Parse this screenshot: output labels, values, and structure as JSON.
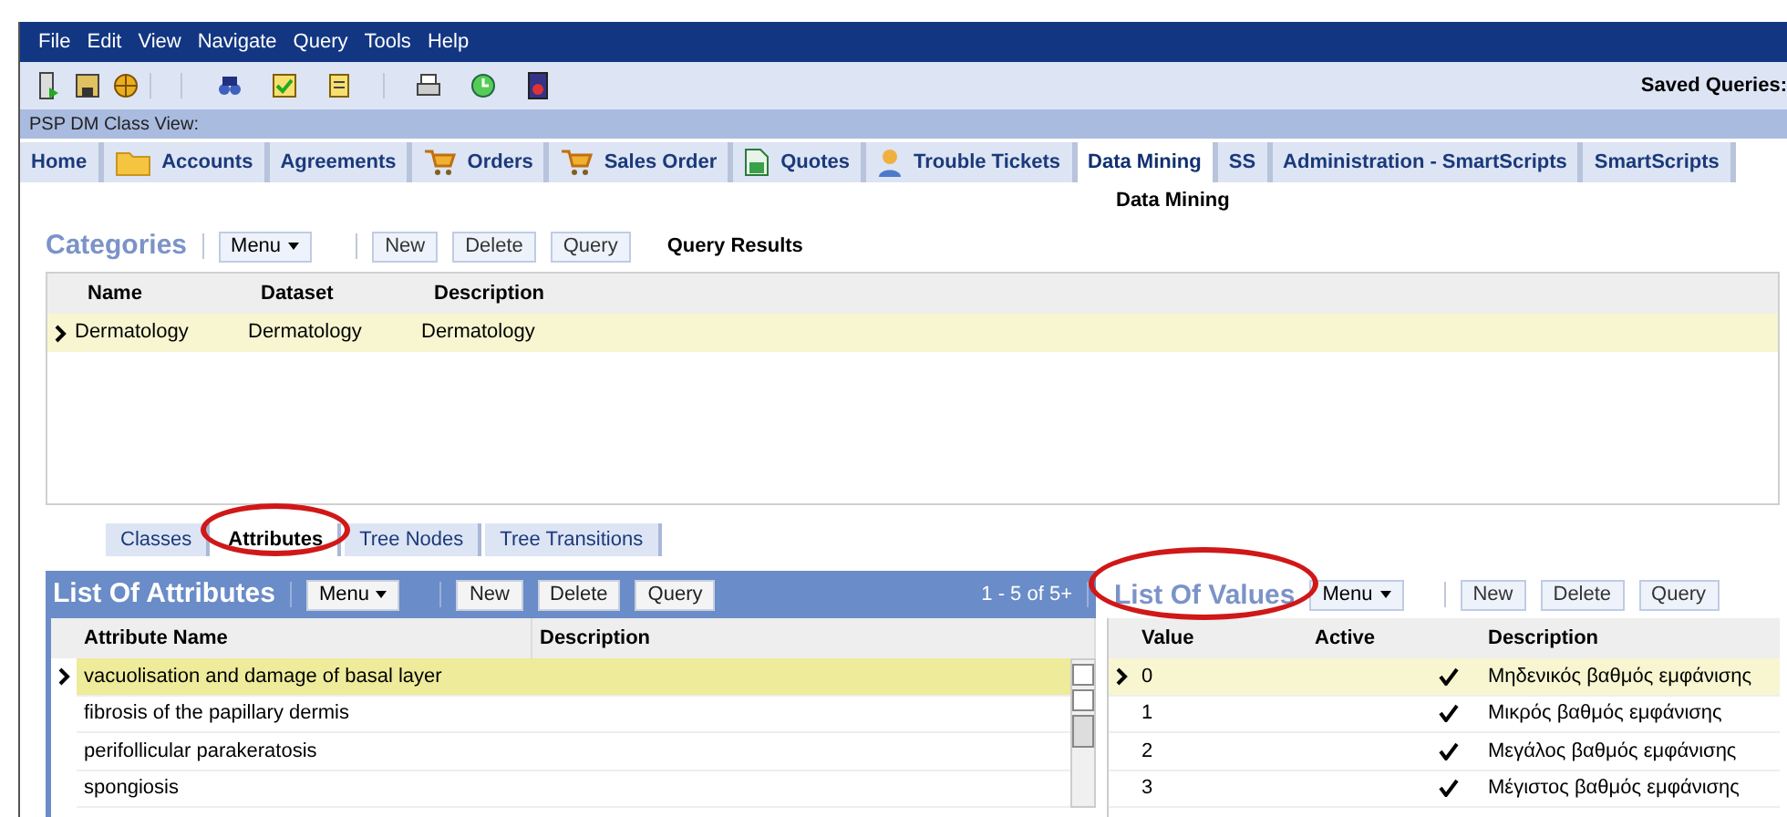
{
  "menu": [
    "File",
    "Edit",
    "View",
    "Navigate",
    "Query",
    "Tools",
    "Help"
  ],
  "saved_queries": "Saved Queries:",
  "view_label": "PSP DM Class View:",
  "tabs": [
    {
      "label": "Home",
      "selected": false
    },
    {
      "label": "Accounts",
      "selected": false
    },
    {
      "label": "Agreements",
      "selected": false
    },
    {
      "label": "Orders",
      "selected": false
    },
    {
      "label": "Sales Order",
      "selected": false
    },
    {
      "label": "Quotes",
      "selected": false
    },
    {
      "label": "Trouble Tickets",
      "selected": false
    },
    {
      "label": "Data Mining",
      "selected": true
    },
    {
      "label": "SS",
      "selected": false
    },
    {
      "label": "Administration - SmartScripts",
      "selected": false
    },
    {
      "label": "SmartScripts",
      "selected": false
    }
  ],
  "subview": "Data Mining",
  "categories": {
    "title": "Categories",
    "menu": "Menu",
    "buttons": [
      "New",
      "Delete",
      "Query"
    ],
    "status": "Query Results",
    "columns": [
      "Name",
      "Dataset",
      "Description"
    ],
    "rows": [
      {
        "cells": [
          "Dermatology",
          "Dermatology",
          "Dermatology"
        ],
        "selected": true
      }
    ]
  },
  "subtabs": [
    {
      "label": "Classes",
      "selected": false
    },
    {
      "label": "Attributes",
      "selected": true
    },
    {
      "label": "Tree Nodes",
      "selected": false
    },
    {
      "label": "Tree Transitions",
      "selected": false
    }
  ],
  "attributes": {
    "title": "List Of Attributes",
    "menu": "Menu",
    "buttons": [
      "New",
      "Delete",
      "Query"
    ],
    "record_count": "1 - 5 of 5+",
    "columns": [
      "Attribute Name",
      "Description"
    ],
    "rows": [
      {
        "name": "vacuolisation and damage of basal layer",
        "selected": true
      },
      {
        "name": "fibrosis of the papillary dermis",
        "selected": false
      },
      {
        "name": "perifollicular parakeratosis",
        "selected": false
      },
      {
        "name": "spongiosis",
        "selected": false
      }
    ]
  },
  "values": {
    "title": "List Of Values",
    "menu": "Menu",
    "buttons": [
      "New",
      "Delete",
      "Query"
    ],
    "columns": [
      "Value",
      "Active",
      "Description"
    ],
    "rows": [
      {
        "value": "0",
        "active": true,
        "description": "Μηδενικός βαθμός εμφάνισης",
        "selected": true
      },
      {
        "value": "1",
        "active": true,
        "description": "Μικρός βαθμός εμφάνισης",
        "selected": false
      },
      {
        "value": "2",
        "active": true,
        "description": "Μεγάλος βαθμός εμφάνισης",
        "selected": false
      },
      {
        "value": "3",
        "active": true,
        "description": "Μέγιστος βαθμός εμφάνισης",
        "selected": false
      }
    ]
  }
}
